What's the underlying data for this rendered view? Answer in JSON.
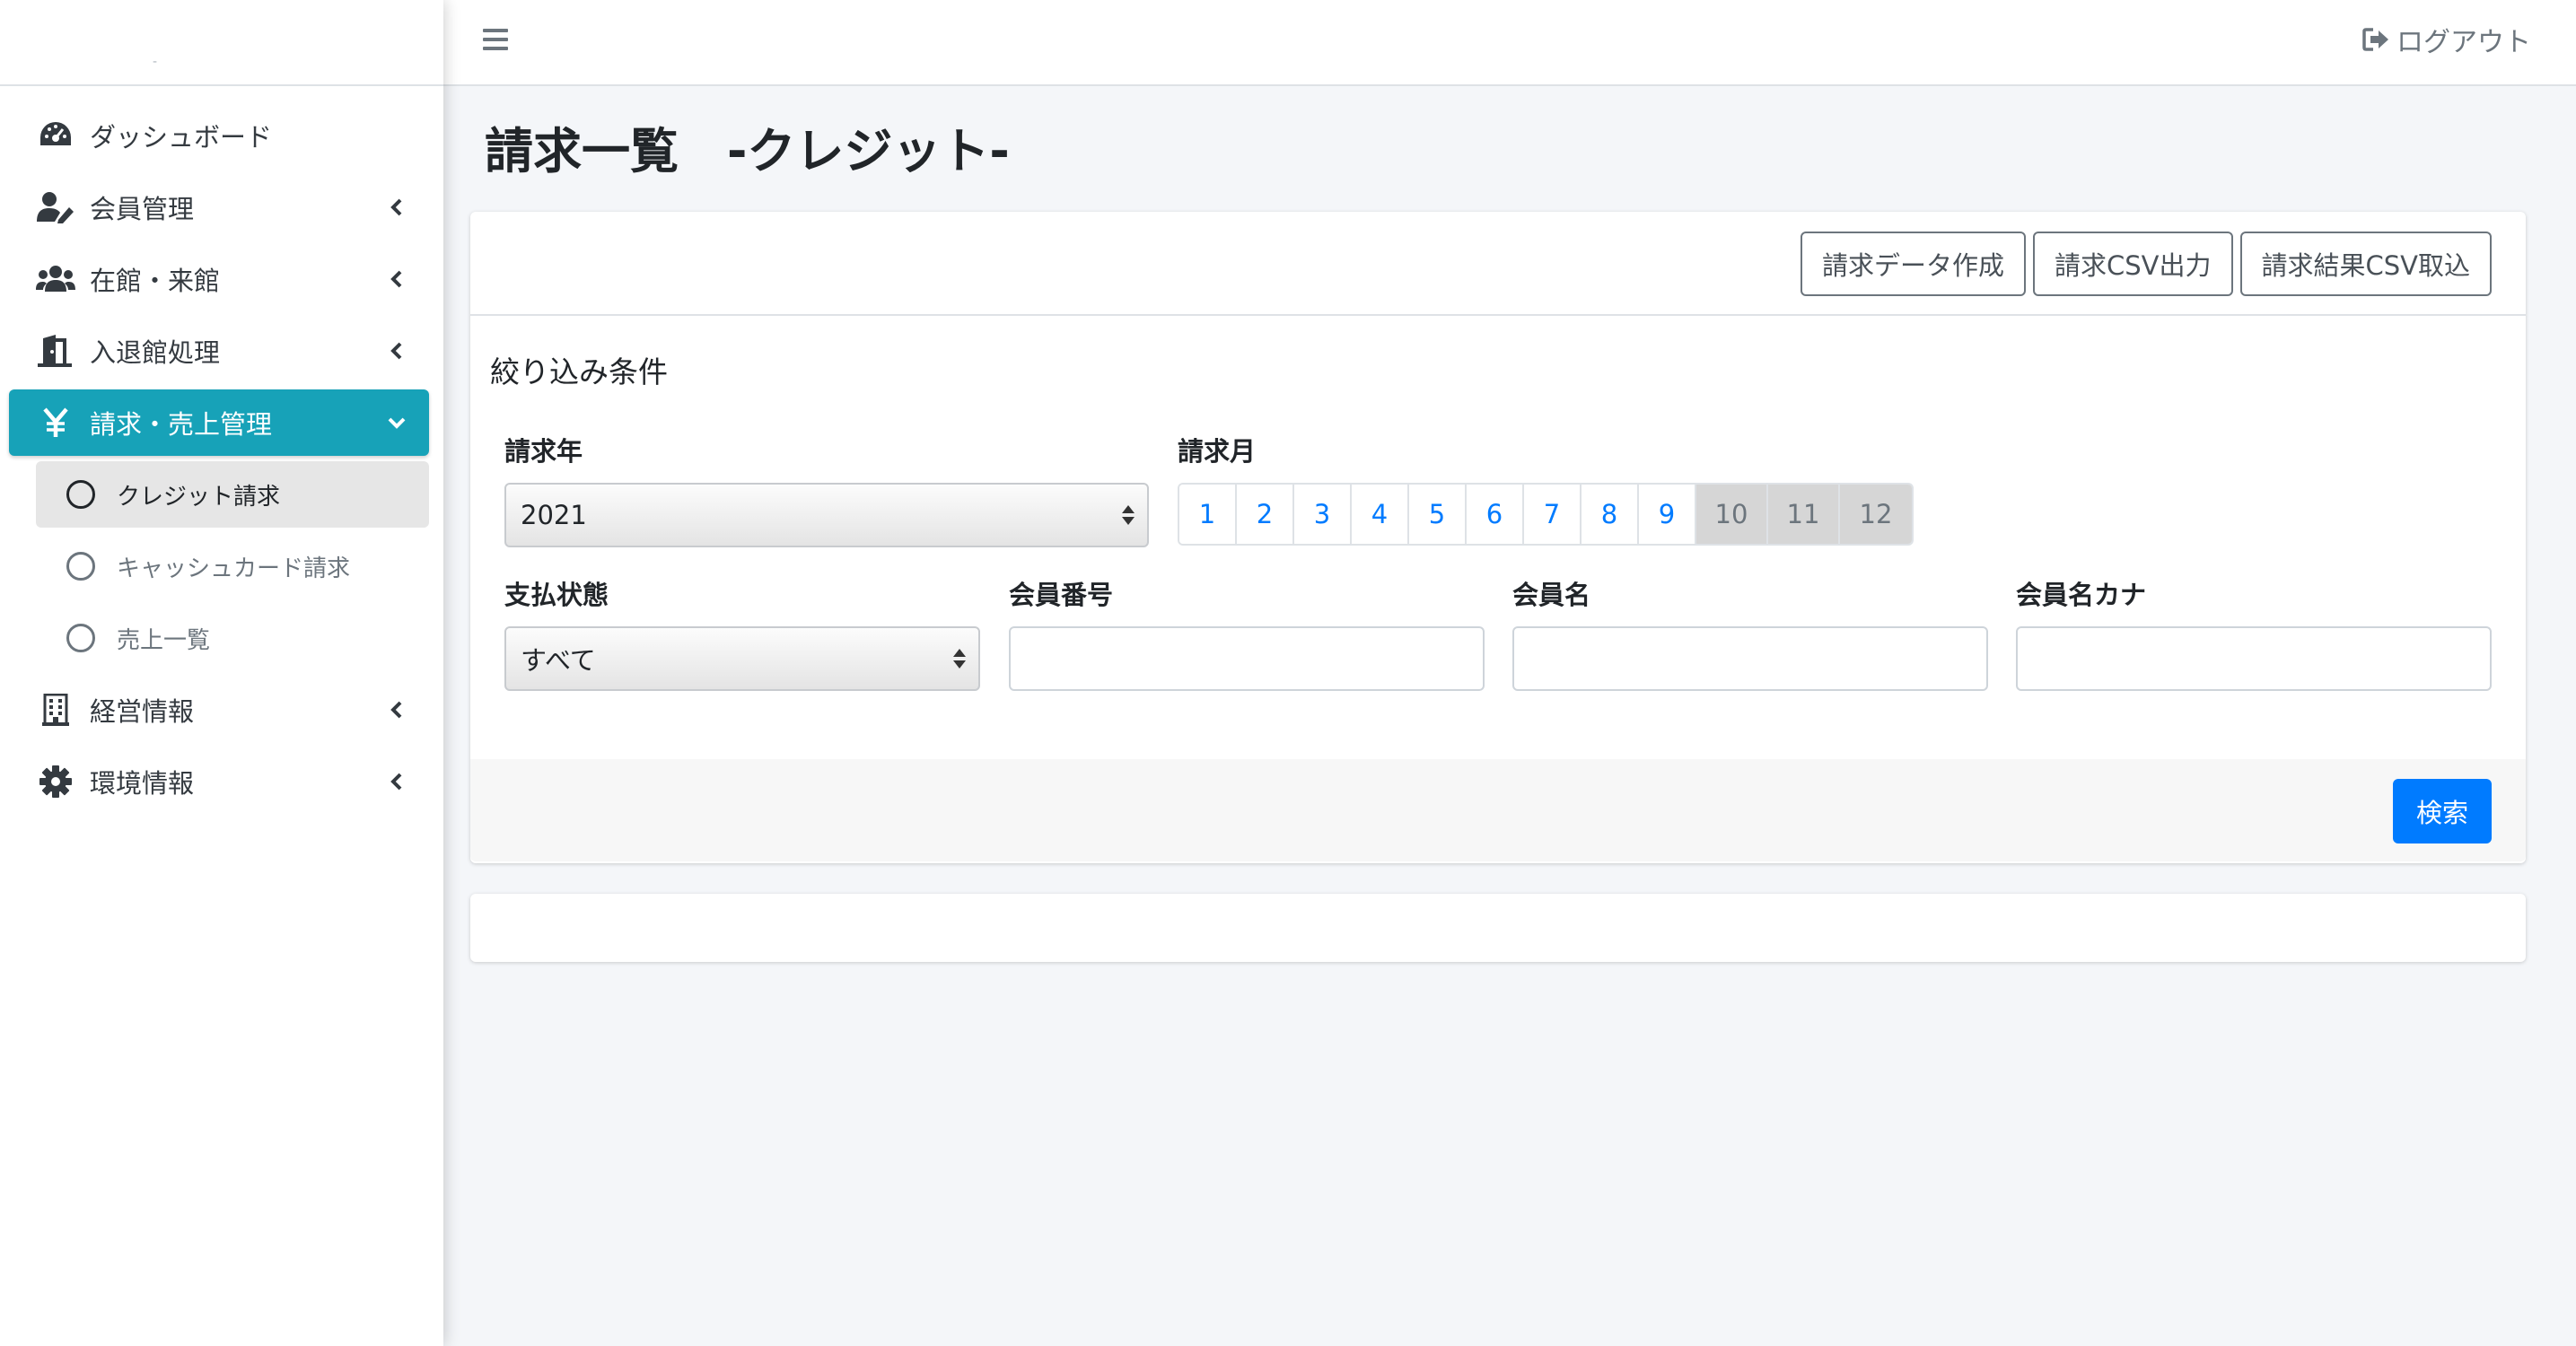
{
  "brand": {
    "mark": "-"
  },
  "sidebar": {
    "items": [
      {
        "label": "ダッシュボード",
        "icon": "dashboard-gauge-icon"
      },
      {
        "label": "会員管理",
        "icon": "user-edit-icon"
      },
      {
        "label": "在館・来館",
        "icon": "users-group-icon"
      },
      {
        "label": "入退館処理",
        "icon": "door-open-icon"
      },
      {
        "label": "請求・売上管理",
        "icon": "yen-icon",
        "active": true
      },
      {
        "label": "経営情報",
        "icon": "building-icon"
      },
      {
        "label": "環境情報",
        "icon": "gear-icon"
      }
    ],
    "subitems": [
      {
        "label": "クレジット請求",
        "selected": true
      },
      {
        "label": "キャッシュカード請求"
      },
      {
        "label": "売上一覧"
      }
    ]
  },
  "topbar": {
    "logout_label": "ログアウト"
  },
  "page": {
    "title": "請求一覧　-クレジット-"
  },
  "card": {
    "buttons": {
      "create": "請求データ作成",
      "export": "請求CSV出力",
      "import": "請求結果CSV取込"
    },
    "filter_title": "絞り込み条件",
    "year": {
      "label": "請求年",
      "value": "2021"
    },
    "month": {
      "label": "請求月",
      "options": [
        "1",
        "2",
        "3",
        "4",
        "5",
        "6",
        "7",
        "8",
        "9",
        "10",
        "11",
        "12"
      ],
      "disabled_from": 10
    },
    "status": {
      "label": "支払状態",
      "value": "すべて"
    },
    "member_number": {
      "label": "会員番号",
      "value": ""
    },
    "member_name": {
      "label": "会員名",
      "value": ""
    },
    "member_kana": {
      "label": "会員名カナ",
      "value": ""
    },
    "search_label": "検索"
  },
  "colors": {
    "active_menu": "#17a2b8",
    "primary": "#007bff",
    "background": "#f4f6f9"
  }
}
